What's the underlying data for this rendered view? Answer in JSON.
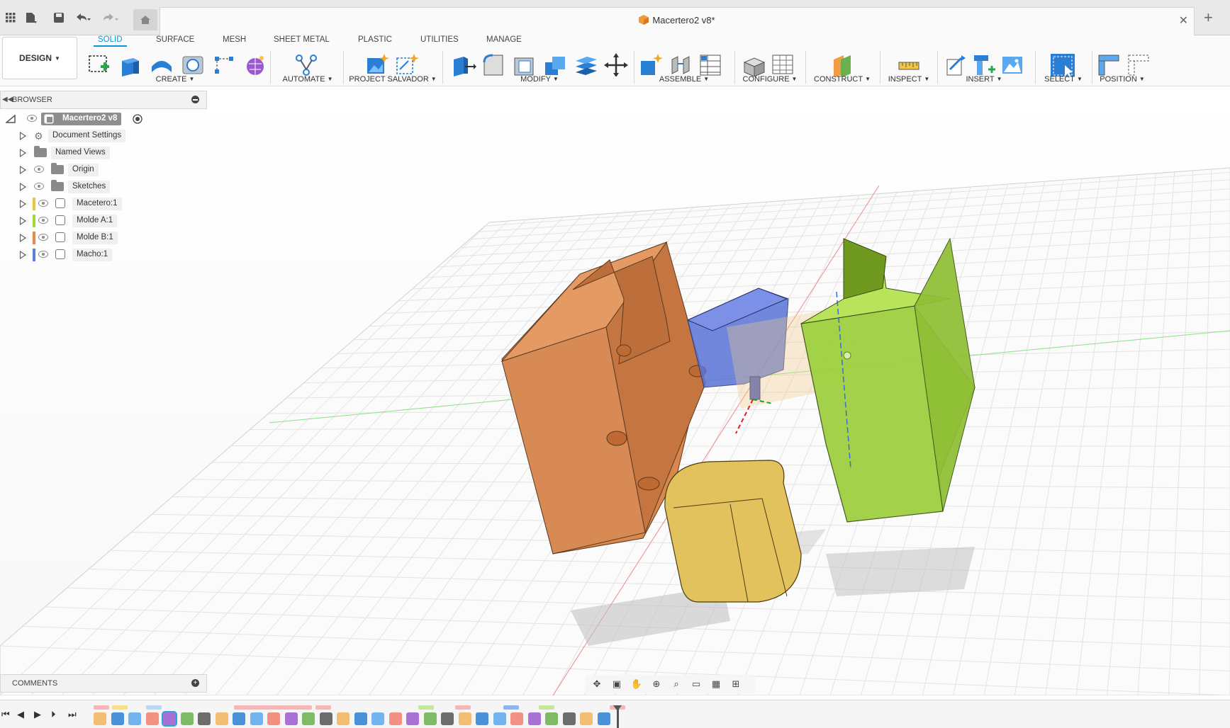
{
  "document": {
    "title": "Macertero2 v8*"
  },
  "workspace": {
    "label": "DESIGN"
  },
  "tabs": [
    {
      "label": "SOLID",
      "active": true
    },
    {
      "label": "SURFACE"
    },
    {
      "label": "MESH"
    },
    {
      "label": "SHEET METAL"
    },
    {
      "label": "PLASTIC"
    },
    {
      "label": "UTILITIES"
    },
    {
      "label": "MANAGE"
    }
  ],
  "groups": [
    {
      "label": "CREATE"
    },
    {
      "label": "AUTOMATE"
    },
    {
      "label": "PROJECT SALVADOR"
    },
    {
      "label": "MODIFY"
    },
    {
      "label": "ASSEMBLE"
    },
    {
      "label": "CONFIGURE"
    },
    {
      "label": "CONSTRUCT"
    },
    {
      "label": "INSPECT"
    },
    {
      "label": "INSERT"
    },
    {
      "label": "SELECT"
    },
    {
      "label": "POSITION"
    }
  ],
  "browser": {
    "title": "BROWSER",
    "root": "Macertero2 v8",
    "items": [
      {
        "label": "Document Settings",
        "type": "settings"
      },
      {
        "label": "Named Views",
        "type": "folder"
      },
      {
        "label": "Origin",
        "type": "folder"
      },
      {
        "label": "Sketches",
        "type": "folder"
      },
      {
        "label": "Macetero:1",
        "type": "component",
        "color": "#e8c547"
      },
      {
        "label": "Molde A:1",
        "type": "component",
        "color": "#a5d63a"
      },
      {
        "label": "Molde B:1",
        "type": "component",
        "color": "#e8894a"
      },
      {
        "label": "Macho:1",
        "type": "component",
        "color": "#5b7ee0"
      }
    ]
  },
  "comments": {
    "title": "COMMENTS"
  },
  "colors": {
    "accent": "#0696d7",
    "mold_b": "#d9874e",
    "core": "#5a73d6",
    "mold_a": "#9ccf3c",
    "pot": "#e2c25c"
  }
}
